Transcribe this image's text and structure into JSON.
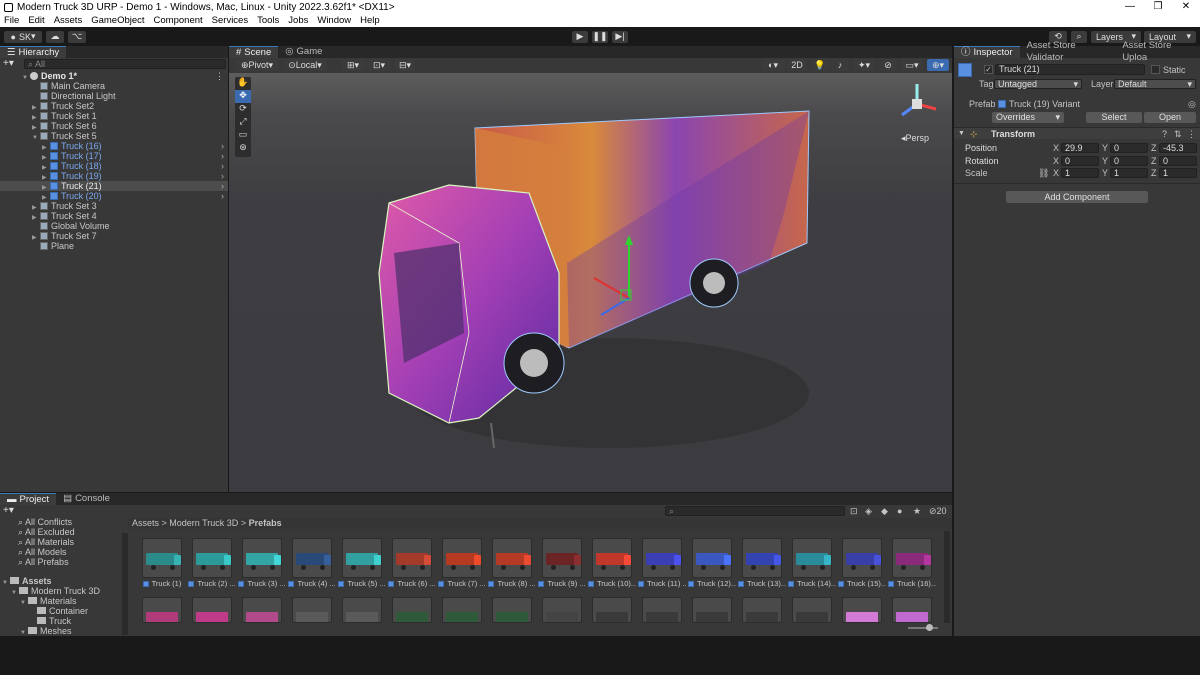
{
  "window": {
    "title": "Modern Truck 3D URP - Demo 1 - Windows, Mac, Linux - Unity 2022.3.62f1* <DX11>",
    "controls": [
      "—",
      "❐",
      "✕"
    ]
  },
  "menu": [
    "File",
    "Edit",
    "Assets",
    "GameObject",
    "Component",
    "Services",
    "Tools",
    "Jobs",
    "Window",
    "Help"
  ],
  "toolbar": {
    "account": "SK",
    "layers": "Layers",
    "layout": "Layout"
  },
  "hierarchy": {
    "tab": "Hierarchy",
    "search_placeholder": "All",
    "scene": "Demo 1*",
    "items": [
      {
        "label": "Main Camera",
        "depth": 1,
        "arrow": ""
      },
      {
        "label": "Directional Light",
        "depth": 1,
        "arrow": ""
      },
      {
        "label": "Truck Set2",
        "depth": 1,
        "arrow": "▶"
      },
      {
        "label": "Truck Set 1",
        "depth": 1,
        "arrow": "▶"
      },
      {
        "label": "Truck Set 6",
        "depth": 1,
        "arrow": "▶"
      },
      {
        "label": "Truck Set 5",
        "depth": 1,
        "arrow": "▼"
      },
      {
        "label": "Truck (16)",
        "depth": 2,
        "arrow": "▶",
        "prefab": true
      },
      {
        "label": "Truck (17)",
        "depth": 2,
        "arrow": "▶",
        "prefab": true
      },
      {
        "label": "Truck (18)",
        "depth": 2,
        "arrow": "▶",
        "prefab": true
      },
      {
        "label": "Truck (19)",
        "depth": 2,
        "arrow": "▶",
        "prefab": true
      },
      {
        "label": "Truck (21)",
        "depth": 2,
        "arrow": "▶",
        "prefab": true,
        "selected": true
      },
      {
        "label": "Truck (20)",
        "depth": 2,
        "arrow": "▶",
        "prefab": true
      },
      {
        "label": "Truck Set 3",
        "depth": 1,
        "arrow": "▶"
      },
      {
        "label": "Truck Set 4",
        "depth": 1,
        "arrow": "▶"
      },
      {
        "label": "Global Volume",
        "depth": 1,
        "arrow": ""
      },
      {
        "label": "Truck Set 7",
        "depth": 1,
        "arrow": "▶"
      },
      {
        "label": "Plane",
        "depth": 1,
        "arrow": ""
      }
    ]
  },
  "scene_view": {
    "tabs": [
      "Scene",
      "Game"
    ],
    "pivot": "Pivot",
    "local": "Local",
    "mode_2d": "2D",
    "persp": "Persp"
  },
  "inspector": {
    "tabs": [
      "Inspector",
      "Asset Store Validator",
      "Asset Store Uploa"
    ],
    "object_name": "Truck (21)",
    "static": "Static",
    "tag_label": "Tag",
    "tag": "Untagged",
    "layer_label": "Layer",
    "layer": "Default",
    "prefab_label": "Prefab",
    "prefab": "Truck (19) Variant",
    "overrides": "Overrides",
    "select": "Select",
    "open": "Open",
    "transform": "Transform",
    "position_label": "Position",
    "rotation_label": "Rotation",
    "scale_label": "Scale",
    "position": {
      "x": "29.9",
      "y": "0",
      "z": "-45.3"
    },
    "rotation": {
      "x": "0",
      "y": "0",
      "z": "0"
    },
    "scale": {
      "x": "1",
      "y": "1",
      "z": "1"
    },
    "add_component": "Add Component"
  },
  "project": {
    "tabs": [
      "Project",
      "Console"
    ],
    "filters": [
      "All Conflicts",
      "All Excluded",
      "All Materials",
      "All Models",
      "All Prefabs"
    ],
    "tree": [
      {
        "label": "Assets",
        "depth": 0
      },
      {
        "label": "Modern Truck 3D",
        "depth": 1
      },
      {
        "label": "Materials",
        "depth": 2
      },
      {
        "label": "Container",
        "depth": 3
      },
      {
        "label": "Truck",
        "depth": 3
      },
      {
        "label": "Meshes",
        "depth": 2
      }
    ],
    "breadcrumb": [
      "Assets",
      "Modern Truck 3D",
      "Prefabs"
    ],
    "count": "20",
    "assets": [
      "Truck (1)",
      "Truck (2) ...",
      "Truck (3) ...",
      "Truck (4) ...",
      "Truck (5) ...",
      "Truck (6) ...",
      "Truck (7) ...",
      "Truck (8) ...",
      "Truck (9) ...",
      "Truck (10)...",
      "Truck (11) ...",
      "Truck (12)...",
      "Truck (13)...",
      "Truck (14)...",
      "Truck (15)...",
      "Truck (16)..."
    ],
    "asset_colors": [
      "#2b8a8a",
      "#2d9a9a",
      "#33a5a5",
      "#294a78",
      "#32a0a0",
      "#a33a2a",
      "#b63a22",
      "#b43a26",
      "#6a2424",
      "#c1382b",
      "#3a3fb6",
      "#3a58c0",
      "#3443b2",
      "#2a8c9a",
      "#3a3fa8",
      "#8a2a7a"
    ],
    "row2_colors": [
      "#b13a7a",
      "#c03a8a",
      "#b04a8a",
      "#5a5a5a",
      "#5a5a5a",
      "#2f5a3a",
      "#2f5a3a",
      "#2f5a3a",
      "#444",
      "#3a3a3a",
      "#3a3a3a",
      "#3a3a3a",
      "#3a3a3a",
      "#3a3a3a",
      "#d37ad6",
      "#c06ad0"
    ]
  }
}
